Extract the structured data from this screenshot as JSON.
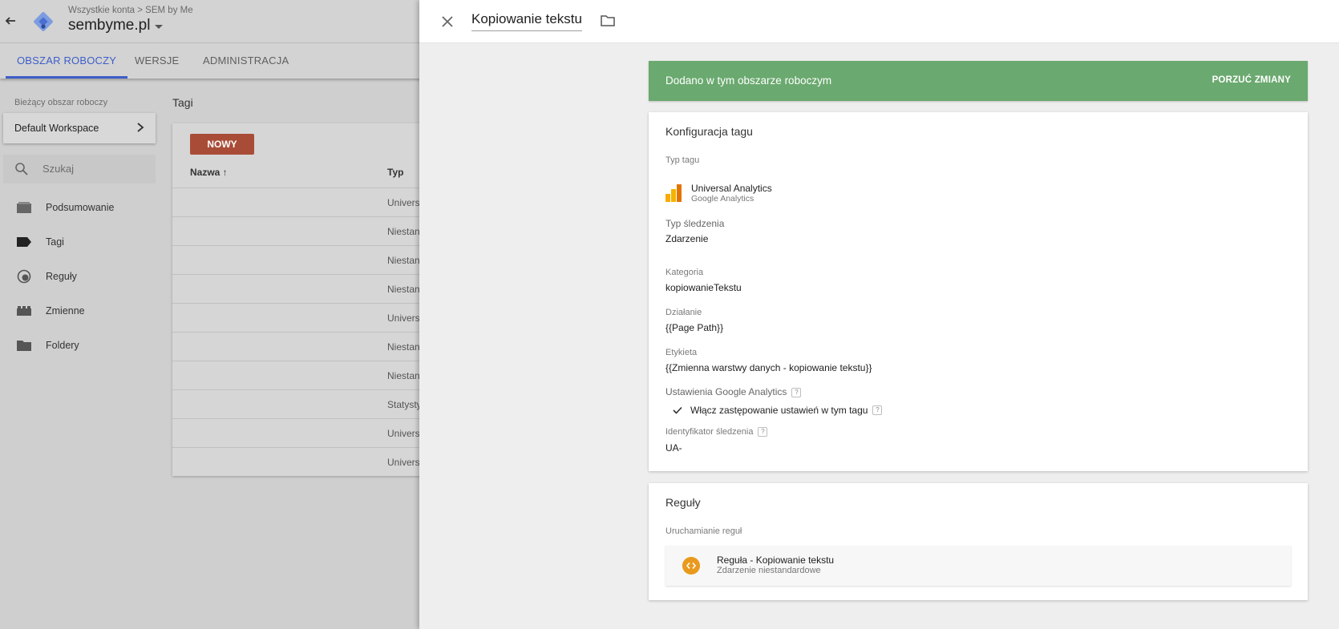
{
  "header": {
    "breadcrumb": "Wszystkie konta > SEM by Me",
    "container": "sembyme.pl"
  },
  "tabs": [
    "OBSZAR ROBOCZY",
    "WERSJE",
    "ADMINISTRACJA"
  ],
  "sidebar": {
    "workspace_label": "Bieżący obszar roboczy",
    "workspace_name": "Default Workspace",
    "search_placeholder": "Szukaj",
    "items": [
      {
        "label": "Podsumowanie",
        "icon": "summary-icon"
      },
      {
        "label": "Tagi",
        "icon": "tag-icon"
      },
      {
        "label": "Reguły",
        "icon": "trigger-icon"
      },
      {
        "label": "Zmienne",
        "icon": "variables-icon"
      },
      {
        "label": "Foldery",
        "icon": "folder-icon"
      }
    ]
  },
  "tags_page": {
    "title": "Tagi",
    "new_button": "NOWY",
    "col_name": "Nazwa ↑",
    "col_type": "Typ",
    "rows": [
      "Universa",
      "Niestan",
      "Niestan",
      "Niestan",
      "Universa",
      "Niestan",
      "Niestan",
      "Statysty",
      "Universa",
      "Universa"
    ]
  },
  "drawer": {
    "title": "Kopiowanie tekstu",
    "banner_text": "Dodano w tym obszarze roboczym",
    "banner_action": "PORZUĆ ZMIANY",
    "config": {
      "card_title": "Konfiguracja tagu",
      "tag_type_label": "Typ tagu",
      "tag_type_name": "Universal Analytics",
      "tag_type_vendor": "Google Analytics",
      "track_type_label": "Typ śledzenia",
      "track_type_value": "Zdarzenie",
      "category_label": "Kategoria",
      "category_value": "kopiowanieTekstu",
      "action_label": "Działanie",
      "action_value": "{{Page Path}}",
      "label_label": "Etykieta",
      "label_value": "{{Zmienna warstwy danych - kopiowanie tekstu}}",
      "ga_settings_label": "Ustawienia Google Analytics",
      "override_label": "Włącz zastępowanie ustawień w tym tagu",
      "tracking_id_label": "Identyfikator śledzenia",
      "tracking_id_value": "UA-",
      "help_glyph": "?"
    },
    "triggers": {
      "card_title": "Reguły",
      "firing_label": "Uruchamianie reguł",
      "trigger_name": "Reguła - Kopiowanie tekstu",
      "trigger_type": "Zdarzenie niestandardowe"
    }
  },
  "colors": {
    "accent": "#3d5ec9",
    "new_button": "#a94c37",
    "banner": "#6aa96f",
    "trigger_icon": "#e99a1e"
  }
}
